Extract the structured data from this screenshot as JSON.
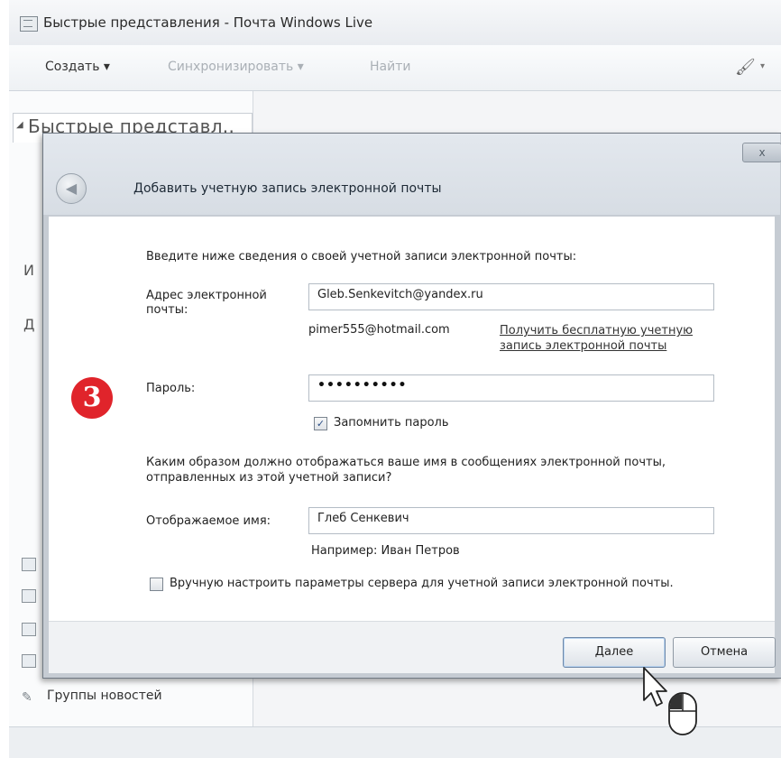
{
  "window": {
    "title": "Быстрые представления - Почта Windows Live"
  },
  "toolbar": {
    "create": "Создать ▾",
    "sync": "Синхронизировать ▾",
    "find": "Найти",
    "brush_icon": "brush-icon"
  },
  "left_pane": {
    "quick_views_title": "Быстрые представл..",
    "fragment_1": "И",
    "fragment_2": "Д",
    "newsgroups_label": "Группы новостей"
  },
  "dialog": {
    "close_label": "x",
    "title": "Добавить учетную запись электронной почты",
    "intro": "Введите ниже сведения о своей учетной записи электронной почты:",
    "email": {
      "label": "Адрес электронной почты:",
      "value": "Gleb.Senkevitch@yandex.ru",
      "example": "pimer555@hotmail.com",
      "free_account_link": "Получить бесплатную учетную запись электронной почты"
    },
    "password": {
      "label": "Пароль:",
      "value": "••••••••••",
      "remember_label": "Запомнить пароль",
      "remember_checked": true
    },
    "display_name": {
      "question": "Каким образом должно отображаться ваше имя в сообщениях электронной почты, отправленных из этой учетной записи?",
      "label": "Отображаемое имя:",
      "value": "Глеб Сенкевич",
      "example": "Например: Иван Петров"
    },
    "manual_server": {
      "label": "Вручную настроить параметры сервера для учетной записи электронной почты.",
      "checked": false
    },
    "buttons": {
      "next": "Далее",
      "cancel": "Отмена"
    }
  },
  "annotation": {
    "step_number": "3",
    "color": "#e0242b"
  }
}
